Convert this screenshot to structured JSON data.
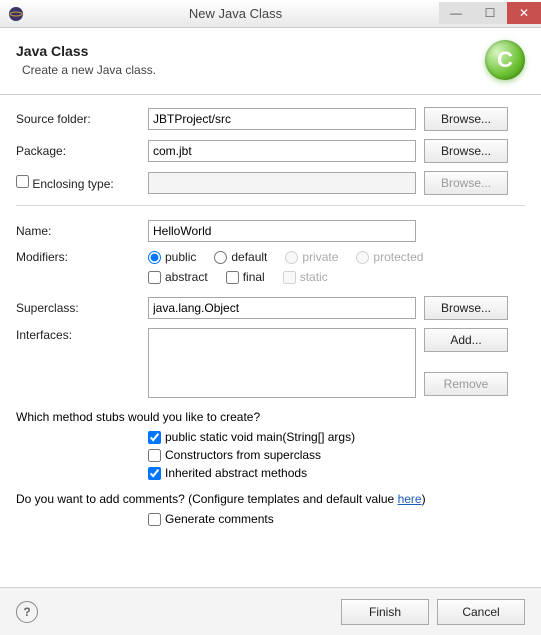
{
  "window": {
    "title": "New Java Class"
  },
  "banner": {
    "title": "Java Class",
    "subtitle": "Create a new Java class."
  },
  "labels": {
    "source_folder": "Source folder:",
    "package": "Package:",
    "enclosing_type": "Enclosing type:",
    "name": "Name:",
    "modifiers": "Modifiers:",
    "superclass": "Superclass:",
    "interfaces": "Interfaces:"
  },
  "fields": {
    "source_folder": "JBTProject/src",
    "package": "com.jbt",
    "enclosing_type": "",
    "name": "HelloWorld",
    "superclass": "java.lang.Object"
  },
  "modifiers": {
    "public": "public",
    "default": "default",
    "private": "private",
    "protected": "protected",
    "abstract": "abstract",
    "final": "final",
    "static": "static"
  },
  "buttons": {
    "browse": "Browse...",
    "add": "Add...",
    "remove": "Remove",
    "finish": "Finish",
    "cancel": "Cancel"
  },
  "questions": {
    "stubs": "Which method stubs would you like to create?",
    "comments_prefix": "Do you want to add comments? (Configure templates and default value ",
    "comments_link": "here",
    "comments_suffix": ")"
  },
  "stubs": {
    "main": "public static void main(String[] args)",
    "constructors": "Constructors from superclass",
    "inherited": "Inherited abstract methods",
    "generate_comments": "Generate comments"
  }
}
